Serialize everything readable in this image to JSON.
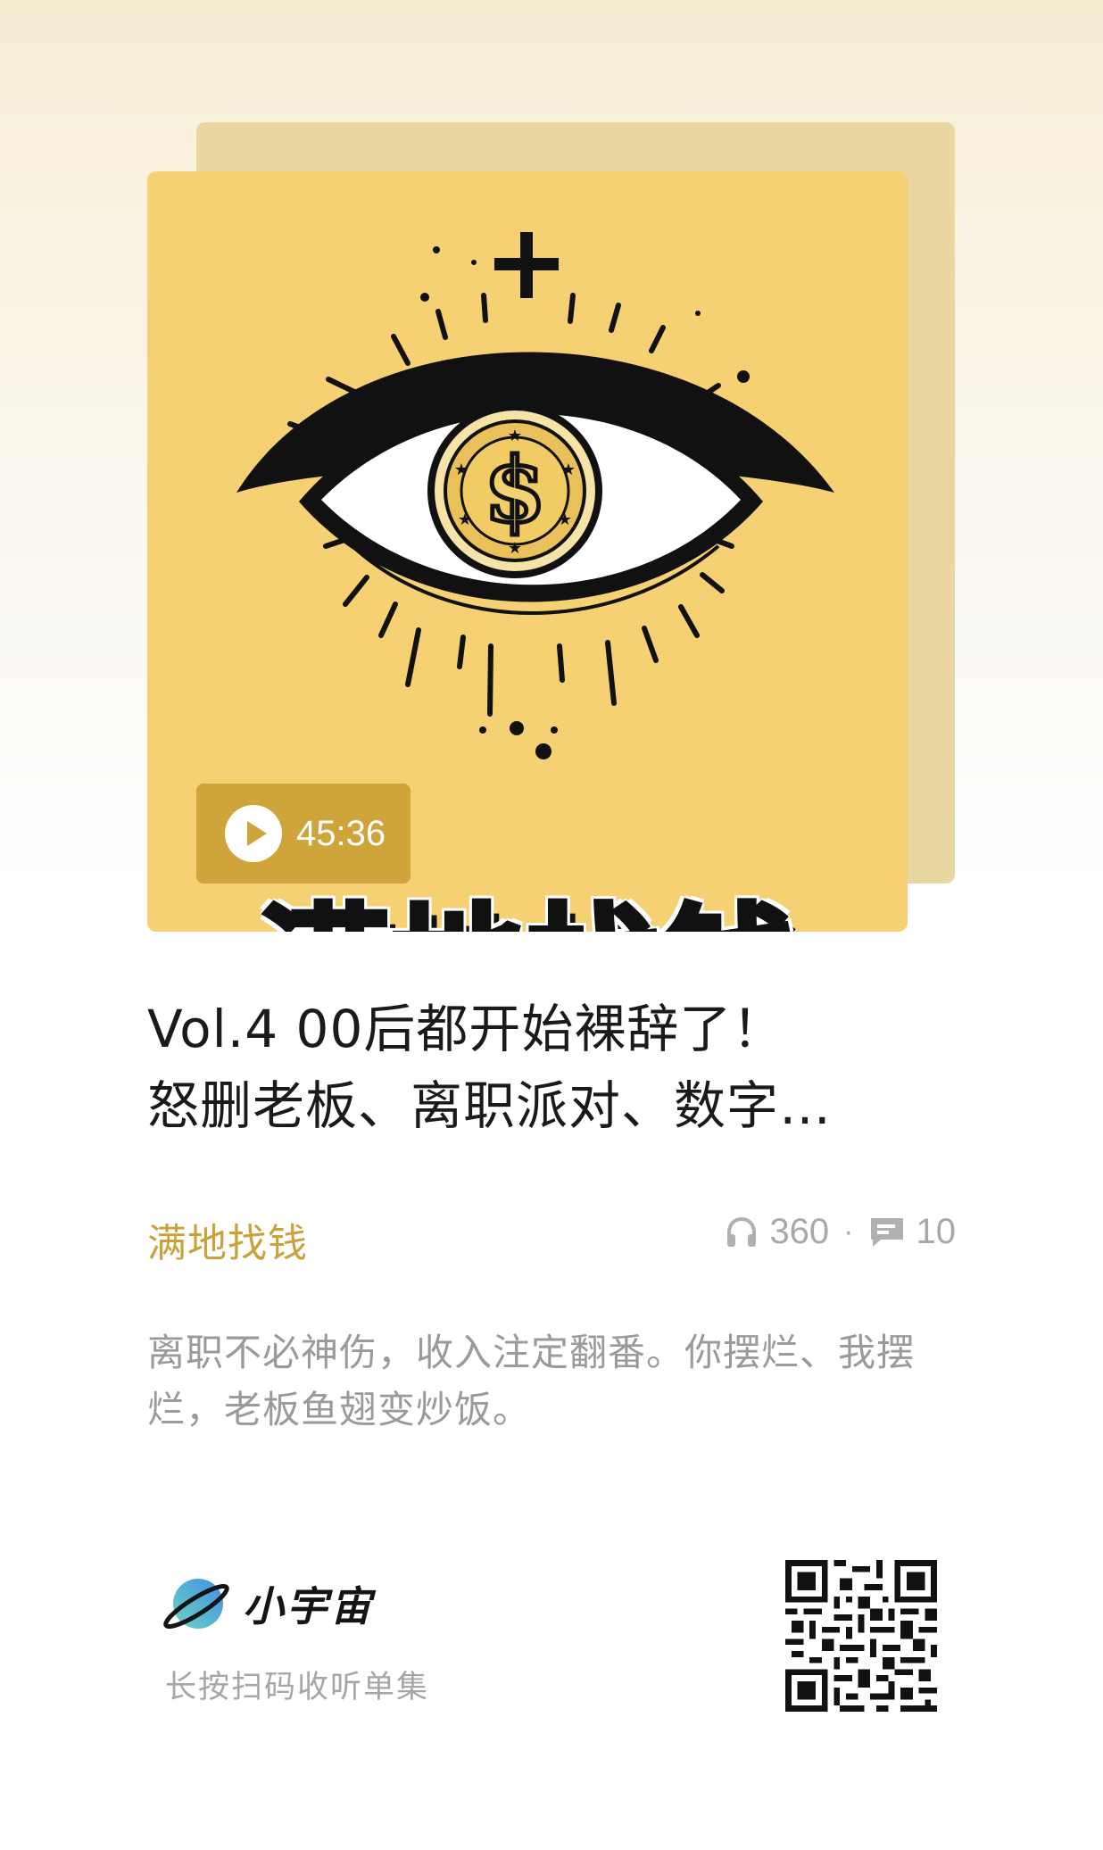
{
  "cover": {
    "artwork_text": "满地找钱",
    "duration": "45:36",
    "play_icon": "play-icon",
    "colors": {
      "cover_bg": "#f6d173",
      "chip_bg": "#cfa43a",
      "backdrop": "#ead6a0"
    }
  },
  "episode": {
    "title_line1": "Vol.4 00后都开始裸辞了！",
    "title_line2": "怒删老板、离职派对、数字…",
    "podcast_name": "满地找钱",
    "listen_count": "360",
    "separator": "·",
    "comment_count": "10",
    "description": "离职不必神伤，收入注定翻番。你摆烂、我摆烂，老板鱼翅变炒饭。"
  },
  "footer": {
    "brand_name": "小宇宙",
    "scan_hint": "长按扫码收听单集",
    "qr_icon": "qr-code-icon",
    "brand_icon": "planet-logo-icon"
  },
  "colors": {
    "accent": "#c9a23a",
    "muted_text": "#9a9a9a",
    "title_text": "#1a1a1a"
  }
}
